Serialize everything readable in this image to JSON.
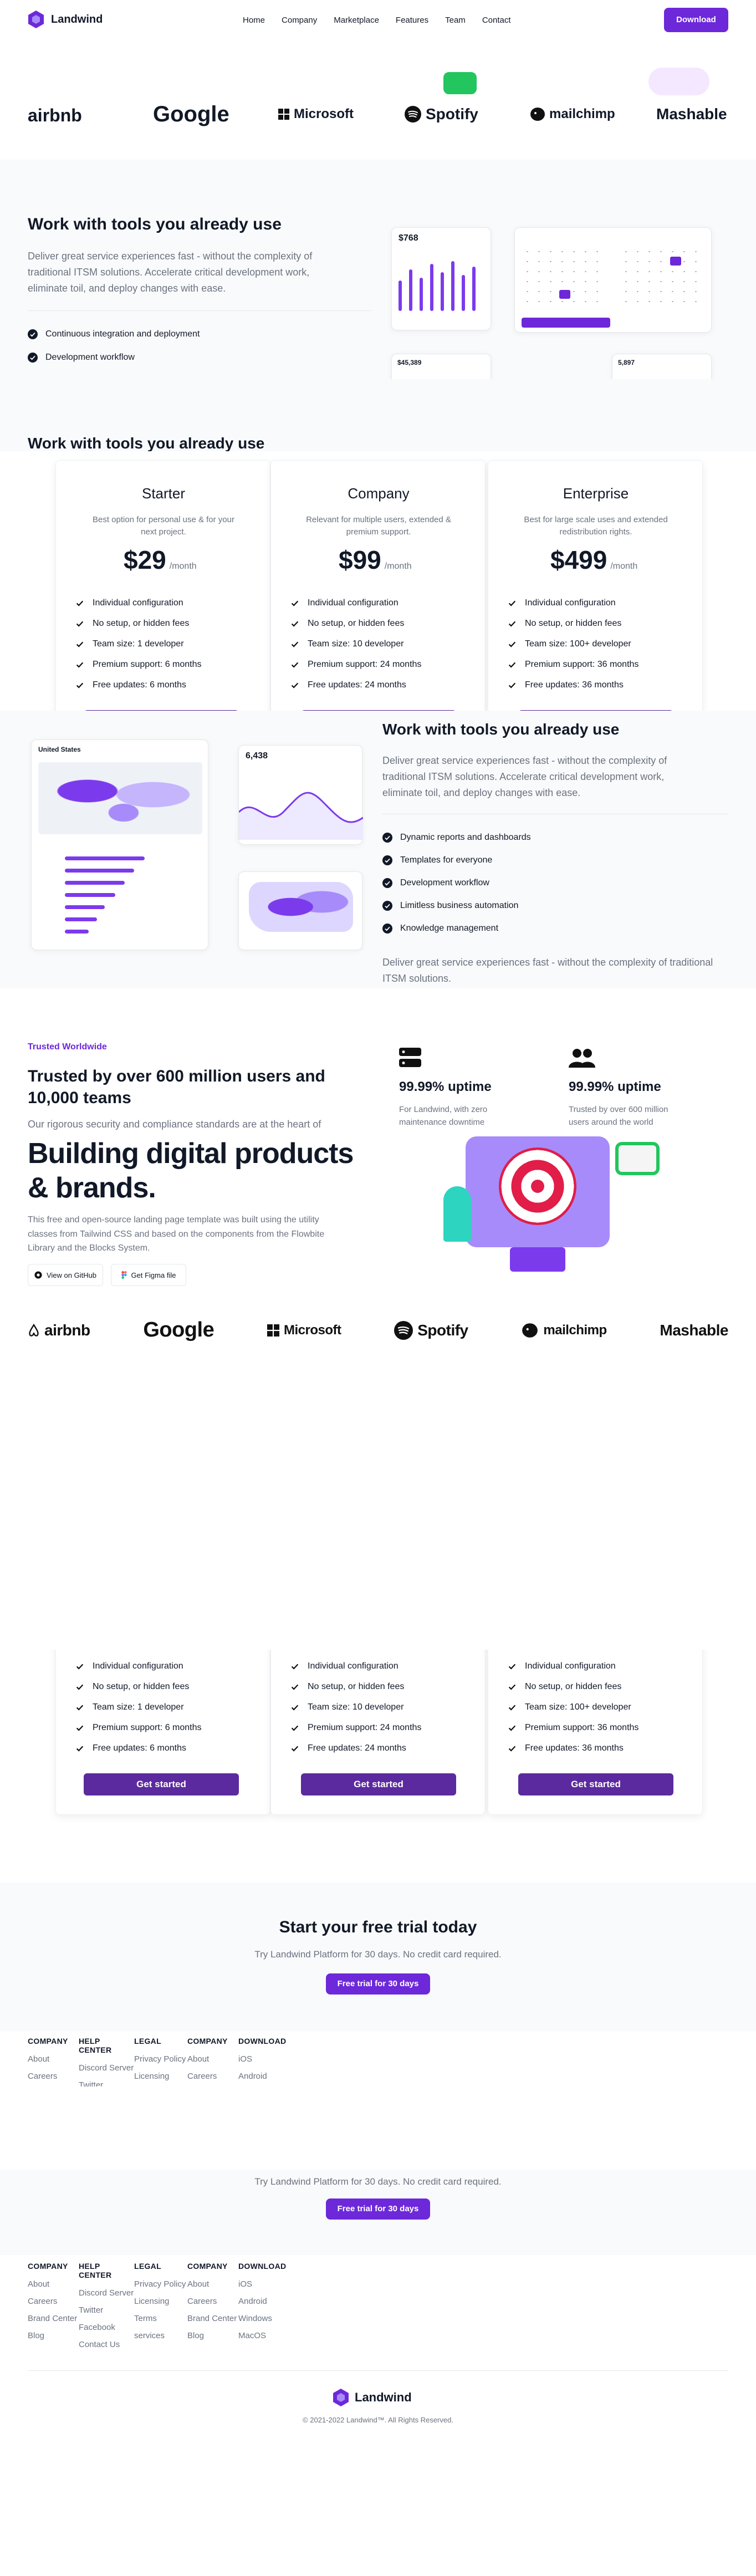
{
  "colors": {
    "accent": "#6d28d9",
    "accent_dark": "#5b2a9e",
    "text": "#111827",
    "muted": "#6b7280",
    "bg_gray": "#f9fafb"
  },
  "nav": {
    "brand": "Landwind",
    "links": [
      "Home",
      "Company",
      "Marketplace",
      "Features",
      "Team",
      "Contact"
    ],
    "cta": "Download"
  },
  "logos": [
    "airbnb",
    "Google",
    "Microsoft",
    "Spotify",
    "mailchimp",
    "Mashable"
  ],
  "tools_section": {
    "title": "Work with tools you already use",
    "desc": "Deliver great service experiences fast - without the complexity of traditional ITSM solutions. Accelerate critical development work, eliminate toil, and deploy changes with ease.",
    "items": [
      "Continuous integration and deployment",
      "Development workflow"
    ],
    "stat_main": "$768",
    "stat_second": "$45,389",
    "stat_third": "5,897"
  },
  "tools_section_2": {
    "title": "Work with tools you already use",
    "desc": "Deliver great service experiences fast - without the complexity of traditional ITSM solutions. Accelerate critical development work, eliminate toil, and deploy changes with ease.",
    "items": [
      "Dynamic reports and dashboards",
      "Templates for everyone",
      "Development workflow",
      "Limitless business automation",
      "Knowledge management"
    ],
    "footer_text": "Deliver great service experiences fast - without the complexity of traditional ITSM solutions.",
    "map_title": "United States",
    "stat": "6,438"
  },
  "pricing": [
    {
      "name": "Starter",
      "desc": "Best option for personal use & for your next project.",
      "price": "$29",
      "per": "/month",
      "features": [
        "Individual configuration",
        "No setup, or hidden fees",
        "Team size: 1 developer",
        "Premium support: 6 months",
        "Free updates: 6 months"
      ],
      "cta": "Get started"
    },
    {
      "name": "Company",
      "desc": "Relevant for multiple users, extended & premium support.",
      "price": "$99",
      "per": "/month",
      "features": [
        "Individual configuration",
        "No setup, or hidden fees",
        "Team size: 10 developer",
        "Premium support: 24 months",
        "Free updates: 24 months"
      ],
      "cta": "Get started"
    },
    {
      "name": "Enterprise",
      "desc": "Best for large scale uses and extended redistribution rights.",
      "price": "$499",
      "per": "/month",
      "features": [
        "Individual configuration",
        "No setup, or hidden fees",
        "Team size: 100+ developer",
        "Premium support: 36 months",
        "Free updates: 36 months"
      ],
      "cta": "Get started"
    }
  ],
  "trusted": {
    "eyebrow": "Trusted Worldwide",
    "title": "Trusted by over 600 million users and 10,000 teams",
    "desc": "Our rigorous security and compliance standards are at the heart of",
    "stat1_title": "99.99% uptime",
    "stat1_desc": "For Landwind, with zero maintenance downtime",
    "stat2_title": "99.99% uptime",
    "stat2_desc": "Trusted by over 600 million users around the world"
  },
  "hero": {
    "title": "Building digital products & brands.",
    "desc": "This free and open-source landing page template was built using the utility classes from Tailwind CSS and based on the components from the Flowbite Library and the Blocks System.",
    "btn_github": "View on GitHub",
    "btn_figma": "Get Figma file"
  },
  "cta_section": {
    "title": "Start your free trial today",
    "desc": "Try Landwind Platform for 30 days. No credit card required.",
    "button": "Free trial for 30 days"
  },
  "footer": {
    "columns": [
      {
        "head": "COMPANY",
        "items": [
          "About",
          "Careers",
          "Brand Center",
          "Blog"
        ]
      },
      {
        "head": "HELP CENTER",
        "items": [
          "Discord Server",
          "Twitter",
          "Facebook",
          "Contact Us"
        ]
      },
      {
        "head": "LEGAL",
        "items": [
          "Privacy Policy",
          "Licensing",
          "Terms",
          "services"
        ]
      },
      {
        "head": "COMPANY",
        "items": [
          "About",
          "Careers",
          "Brand Center",
          "Blog"
        ]
      },
      {
        "head": "DOWNLOAD",
        "items": [
          "iOS",
          "Android",
          "Windows",
          "MacOS"
        ]
      }
    ],
    "brand": "Landwind",
    "copyright": "© 2021-2022 Landwind™. All Rights Reserved."
  }
}
